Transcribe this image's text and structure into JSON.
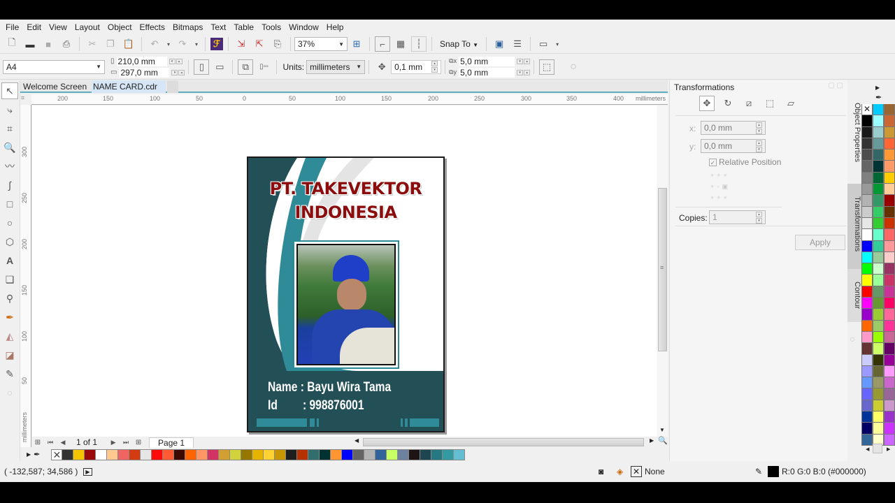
{
  "menu": [
    "File",
    "Edit",
    "View",
    "Layout",
    "Object",
    "Effects",
    "Bitmaps",
    "Text",
    "Table",
    "Tools",
    "Window",
    "Help"
  ],
  "toolbar": {
    "zoom": "37%",
    "snap_to": "Snap To"
  },
  "propbar": {
    "page_size": "A4",
    "width": "210,0 mm",
    "height": "297,0 mm",
    "units_label": "Units:",
    "units": "millimeters",
    "nudge": "0,1 mm",
    "dup_x": "5,0 mm",
    "dup_y": "5,0 mm"
  },
  "tabs": [
    "Welcome Screen",
    "NAME CARD.cdr"
  ],
  "ruler": {
    "h_labels": [
      "200",
      "150",
      "100",
      "50",
      "0",
      "50",
      "100",
      "150",
      "200",
      "250",
      "300",
      "350",
      "400"
    ],
    "h_unit": "millimeters",
    "v_labels": [
      "300",
      "250",
      "200",
      "150",
      "100",
      "50"
    ],
    "v_unit": "millimeters"
  },
  "card": {
    "company_line1": "PT. TAKEVEKTOR",
    "company_line2": "INDONESIA",
    "name_line": "Name : Bayu Wira Tama",
    "id_label": "Id",
    "id_value": ": 998876001",
    "colors": {
      "teal_dark": "#234f57",
      "teal": "#2f8b98",
      "title": "#8b0d0d"
    }
  },
  "pagebar": {
    "page_count": "1 of 1",
    "page_tab": "Page 1"
  },
  "doc_palette": [
    "#333333",
    "#f5c400",
    "#9a0a0a",
    "#ffffff",
    "#ffc890",
    "#f06464",
    "#d23c10",
    "#e6e6e6",
    "#ff0a0a",
    "#ff5a32",
    "#3c0a00",
    "#ff6400",
    "#ff9664",
    "#d23264",
    "#d2a032",
    "#d2d23c",
    "#967800",
    "#e6b400",
    "#ffd232",
    "#c89600",
    "#1e1e1e",
    "#b43200",
    "#326e6e",
    "#003232",
    "#ff9632",
    "#0000ff",
    "#646464",
    "#b4b4b4",
    "#32649b",
    "#c8ff64",
    "#6e82a0",
    "#1e1414",
    "#1e4650",
    "#287882",
    "#329aa0",
    "#64bed2"
  ],
  "docker": {
    "title": "Transformations",
    "x_label": "x:",
    "x_value": "0,0 mm",
    "y_label": "y:",
    "y_value": "0,0 mm",
    "relative_position": "Relative Position",
    "copies_label": "Copies:",
    "copies_value": "1",
    "apply": "Apply",
    "side_tabs": [
      "Object Properties",
      "Transformations",
      "Contour"
    ]
  },
  "palette_cols": [
    [
      "none",
      "#000000",
      "#1a1a1a",
      "#333333",
      "#4d4d4d",
      "#666666",
      "#808080",
      "#999999",
      "#b3b3b3",
      "#cccccc",
      "#e6e6e6",
      "#ffffff",
      "#0000ff",
      "#00ffff",
      "#00ff00",
      "#ffff00",
      "#ff0000",
      "#ff00ff",
      "#9900cc",
      "#ff6600",
      "#ff99cc",
      "#663333",
      "#ccccff",
      "#9999ff",
      "#6699ff",
      "#6666ff",
      "#6666cc",
      "#003399",
      "#000066",
      "#336699"
    ],
    [
      "#00ccff",
      "#99ffff",
      "#99cccc",
      "#669999",
      "#336666",
      "#003333",
      "#006633",
      "#009933",
      "#339966",
      "#33cc66",
      "#33cc33",
      "#66ffcc",
      "#33cc99",
      "#99cc99",
      "#ccffcc",
      "#99ff99",
      "#669966",
      "#669933",
      "#99cc33",
      "#99cc66",
      "#99ff00",
      "#ccff66",
      "#333300",
      "#666633",
      "#999966",
      "#999933",
      "#cccc33",
      "#ffff66",
      "#ffff99",
      "#ffffcc"
    ],
    [
      "#996633",
      "#cc6633",
      "#cc9933",
      "#ff6633",
      "#ff9933",
      "#ff9966",
      "#ffcc00",
      "#ffcc99",
      "#990000",
      "#663300",
      "#cc3300",
      "#ff6666",
      "#ff9999",
      "#ffcccc",
      "#993366",
      "#cc3366",
      "#cc3399",
      "#ff0066",
      "#ff6699",
      "#ff3399",
      "#cc6699",
      "#660066",
      "#990099",
      "#ff99ff",
      "#cc66cc",
      "#996699",
      "#cc99cc",
      "#9933cc",
      "#cc33ff",
      "#cc66ff"
    ]
  ],
  "status": {
    "coords": "( -132,587; 34,586 )",
    "fill": "None",
    "outline": "R:0 G:0 B:0 (#000000)"
  }
}
